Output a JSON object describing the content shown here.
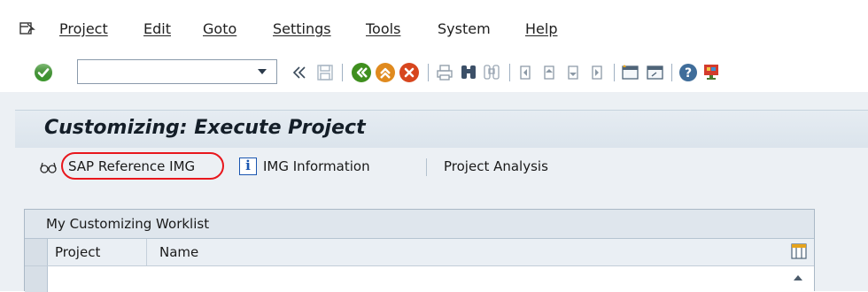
{
  "menubar": {
    "items": [
      "Project",
      "Edit",
      "Goto",
      "Settings",
      "Tools",
      "System",
      "Help"
    ]
  },
  "toolbar": {
    "command_value": "",
    "icons": [
      "enter-icon",
      "command-dropdown-icon",
      "collapse-icon",
      "save-icon",
      "back-icon",
      "exit-icon",
      "cancel-icon",
      "print-icon",
      "find-icon",
      "find-next-icon",
      "first-page-icon",
      "previous-page-icon",
      "next-page-icon",
      "last-page-icon",
      "create-session-icon",
      "shortcut-icon",
      "help-icon",
      "customize-layout-icon"
    ]
  },
  "screen": {
    "title": "Customizing: Execute Project",
    "app_toolbar": {
      "sap_reference_img": "SAP Reference IMG",
      "img_information": "IMG Information",
      "project_analysis": "Project Analysis",
      "info_glyph": "i"
    }
  },
  "worklist": {
    "title": "My Customizing Worklist",
    "columns": [
      "Project",
      "Name"
    ],
    "rows": []
  },
  "colors": {
    "accent_highlight": "#e8171d",
    "title_band": "#dbe4ec",
    "screen_bg": "#ecf0f4",
    "enter_green": "#3e9a2f",
    "back_green": "#3f8f1e",
    "exit_orange": "#e08a1e",
    "cancel_red": "#d7461e"
  }
}
